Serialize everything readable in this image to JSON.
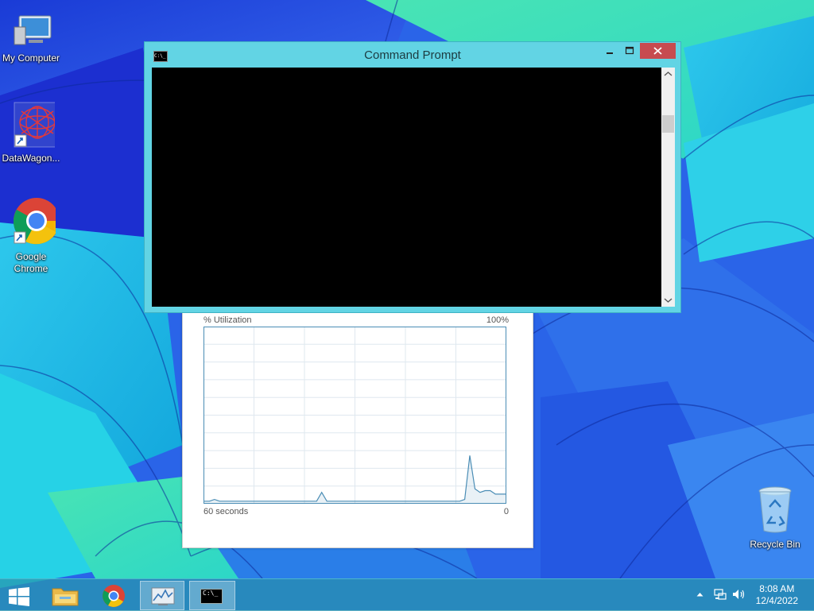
{
  "desktop": {
    "icons": [
      {
        "label": "My Computer"
      },
      {
        "label": "DataWagon..."
      },
      {
        "label": "Google Chrome"
      },
      {
        "label": "Recycle Bin"
      }
    ]
  },
  "cmd_window": {
    "title": "Command Prompt",
    "app_icon_text": "C:\\_"
  },
  "perf_panel": {
    "y_label": "% Utilization",
    "y_max": "100%",
    "x_label": "60 seconds",
    "x_min": "0",
    "utilization_pct": [
      1,
      1,
      2,
      1,
      1,
      1,
      1,
      1,
      1,
      1,
      1,
      1,
      1,
      1,
      1,
      1,
      1,
      1,
      1,
      1,
      1,
      1,
      1,
      6,
      1,
      1,
      1,
      1,
      1,
      1,
      1,
      1,
      1,
      1,
      1,
      1,
      1,
      1,
      1,
      1,
      1,
      1,
      1,
      1,
      1,
      1,
      1,
      1,
      1,
      1,
      1,
      2,
      27,
      8,
      6,
      7,
      7,
      5,
      5,
      5
    ]
  },
  "taskbar": {
    "time": "8:08 AM",
    "date": "12/4/2022",
    "cmd_button_text": "C:\\_"
  },
  "colors": {
    "titlebar": "#62d4e4",
    "close": "#c74b50",
    "taskbar": "#2896af",
    "graph_line": "#4a8db5"
  }
}
